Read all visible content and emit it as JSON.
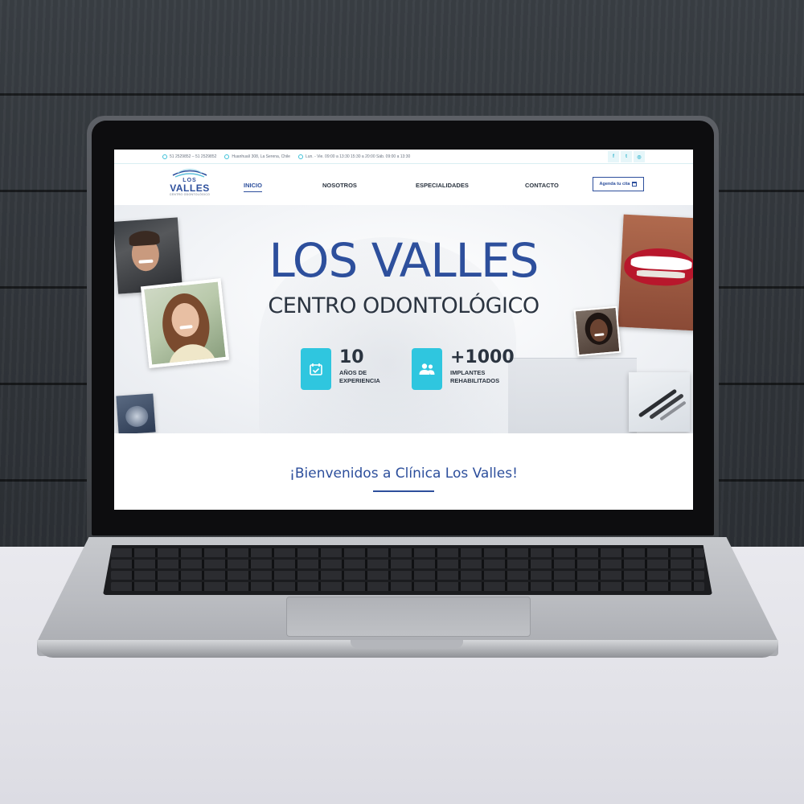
{
  "topbar": {
    "phone": "51 2529852 – 51 2529852",
    "address": "Huanhualí 308, La Serena, Chile",
    "hours": "Lun. - Vie. 09:00 a 13:30 15:30 a 20:00 Sáb. 09:00 a 13:30",
    "social": [
      {
        "icon": "facebook-icon",
        "glyph": "f"
      },
      {
        "icon": "twitter-icon",
        "glyph": "t"
      },
      {
        "icon": "instagram-icon",
        "glyph": "◎"
      }
    ]
  },
  "logo": {
    "line1": "LOS",
    "line2": "VALLES",
    "line3": "CENTRO ODONTOLÓGICO"
  },
  "nav": {
    "items": [
      {
        "label": "INICIO",
        "active": true
      },
      {
        "label": "NOSOTROS",
        "active": false
      },
      {
        "label": "ESPECIALIDADES",
        "active": false
      },
      {
        "label": "CONTACTO",
        "active": false
      }
    ],
    "cta": "Agenda tu cita"
  },
  "hero": {
    "title": "LOS VALLES",
    "subtitle": "CENTRO ODONTOLÓGICO",
    "stats": [
      {
        "number": "10",
        "label": "AÑOS DE EXPERIENCIA",
        "icon": "calendar-check-icon"
      },
      {
        "number": "+1000",
        "label": "IMPLANTES REHABILITADOS",
        "icon": "users-icon"
      }
    ]
  },
  "welcome": {
    "heading": "¡Bienvenidos a Clínica Los Valles!"
  },
  "colors": {
    "brand": "#2d4f9c",
    "accent": "#2fc6df",
    "text": "#2b3440"
  }
}
